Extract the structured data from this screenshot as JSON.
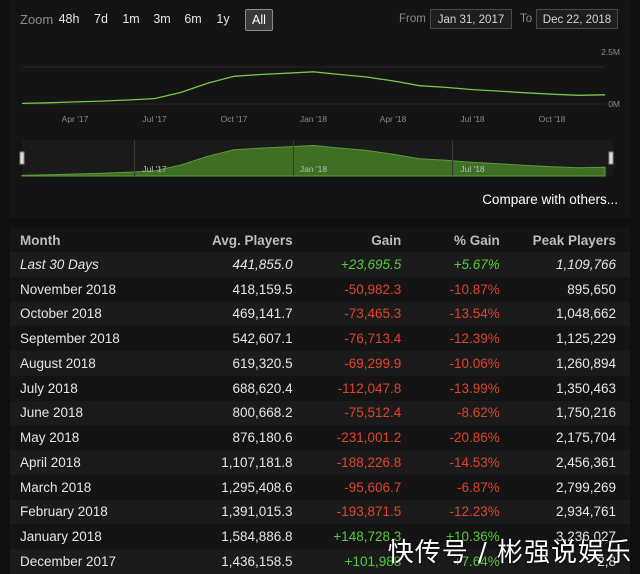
{
  "zoom": {
    "label": "Zoom",
    "buttons": [
      "48h",
      "7d",
      "1m",
      "3m",
      "6m",
      "1y",
      "All"
    ],
    "active": "All"
  },
  "range": {
    "from_label": "From",
    "from": "Jan 31, 2017",
    "to_label": "To",
    "to": "Dec 22, 2018"
  },
  "compare_label": "Compare with others...",
  "chart_data": [
    {
      "type": "line",
      "x_ticks": [
        "Apr '17",
        "Jul '17",
        "Oct '17",
        "Jan '18",
        "Apr '18",
        "Jul '18",
        "Oct '18"
      ],
      "y_ticks": [
        "2.5M",
        "0M"
      ],
      "ylim": [
        0,
        2500000
      ],
      "x": [
        "Feb '17",
        "Mar '17",
        "Apr '17",
        "May '17",
        "Jun '17",
        "Jul '17",
        "Aug '17",
        "Sep '17",
        "Oct '17",
        "Nov '17",
        "Dec '17",
        "Jan '18",
        "Feb '18",
        "Mar '18",
        "Apr '18",
        "May '18",
        "Jun '18",
        "Jul '18",
        "Aug '18",
        "Sep '18",
        "Oct '18",
        "Nov '18",
        "Dec '18"
      ],
      "values": [
        30000,
        60000,
        100000,
        140000,
        190000,
        260000,
        560000,
        1000000,
        1330000,
        1420000,
        1480000,
        1550000,
        1420000,
        1300000,
        1110000,
        880000,
        800000,
        690000,
        620000,
        540000,
        470000,
        420000,
        440000
      ],
      "color": "#77c84a"
    },
    {
      "type": "area",
      "role": "navigator",
      "x_ticks": [
        "Jul '17",
        "Jan '18",
        "Jul '18"
      ],
      "x": [
        "Feb '17",
        "Mar '17",
        "Apr '17",
        "May '17",
        "Jun '17",
        "Jul '17",
        "Aug '17",
        "Sep '17",
        "Oct '17",
        "Nov '17",
        "Dec '17",
        "Jan '18",
        "Feb '18",
        "Mar '18",
        "Apr '18",
        "May '18",
        "Jun '18",
        "Jul '18",
        "Aug '18",
        "Sep '18",
        "Oct '18",
        "Nov '18",
        "Dec '18"
      ],
      "values": [
        30000,
        60000,
        100000,
        140000,
        190000,
        260000,
        560000,
        1000000,
        1330000,
        1420000,
        1480000,
        1550000,
        1420000,
        1300000,
        1110000,
        880000,
        800000,
        690000,
        620000,
        540000,
        470000,
        420000,
        440000
      ],
      "color": "#3f6e25"
    },
    {
      "type": "table",
      "columns": [
        "Month",
        "Avg. Players",
        "Gain",
        "% Gain",
        "Peak Players"
      ],
      "rows": [
        {
          "month": "Last 30 Days",
          "avg": "441,855.0",
          "gain": "+23,695.5",
          "pct": "+5.67%",
          "peak": "1,109,766",
          "sign": "pos"
        },
        {
          "month": "November 2018",
          "avg": "418,159.5",
          "gain": "-50,982.3",
          "pct": "-10.87%",
          "peak": "895,650",
          "sign": "neg"
        },
        {
          "month": "October 2018",
          "avg": "469,141.7",
          "gain": "-73,465.3",
          "pct": "-13.54%",
          "peak": "1,048,662",
          "sign": "neg"
        },
        {
          "month": "September 2018",
          "avg": "542,607.1",
          "gain": "-76,713.4",
          "pct": "-12.39%",
          "peak": "1,125,229",
          "sign": "neg"
        },
        {
          "month": "August 2018",
          "avg": "619,320.5",
          "gain": "-69,299.9",
          "pct": "-10.06%",
          "peak": "1,260,894",
          "sign": "neg"
        },
        {
          "month": "July 2018",
          "avg": "688,620.4",
          "gain": "-112,047.8",
          "pct": "-13.99%",
          "peak": "1,350,463",
          "sign": "neg"
        },
        {
          "month": "June 2018",
          "avg": "800,668.2",
          "gain": "-75,512.4",
          "pct": "-8.62%",
          "peak": "1,750,216",
          "sign": "neg"
        },
        {
          "month": "May 2018",
          "avg": "876,180.6",
          "gain": "-231,001.2",
          "pct": "-20.86%",
          "peak": "2,175,704",
          "sign": "neg"
        },
        {
          "month": "April 2018",
          "avg": "1,107,181.8",
          "gain": "-188,226.8",
          "pct": "-14.53%",
          "peak": "2,456,361",
          "sign": "neg"
        },
        {
          "month": "March 2018",
          "avg": "1,295,408.6",
          "gain": "-95,606.7",
          "pct": "-6.87%",
          "peak": "2,799,269",
          "sign": "neg"
        },
        {
          "month": "February 2018",
          "avg": "1,391,015.3",
          "gain": "-193,871.5",
          "pct": "-12.23%",
          "peak": "2,934,761",
          "sign": "neg"
        },
        {
          "month": "January 2018",
          "avg": "1,584,886.8",
          "gain": "+148,728.3",
          "pct": "+10.36%",
          "peak": "3,236,027",
          "sign": "pos"
        },
        {
          "month": "December 2017",
          "avg": "1,436,158.5",
          "gain": "+101,988",
          "pct": "+7.64%",
          "peak": "2,8",
          "sign": "pos"
        }
      ]
    }
  ],
  "watermark": "快传号 / 彬强说娱乐"
}
